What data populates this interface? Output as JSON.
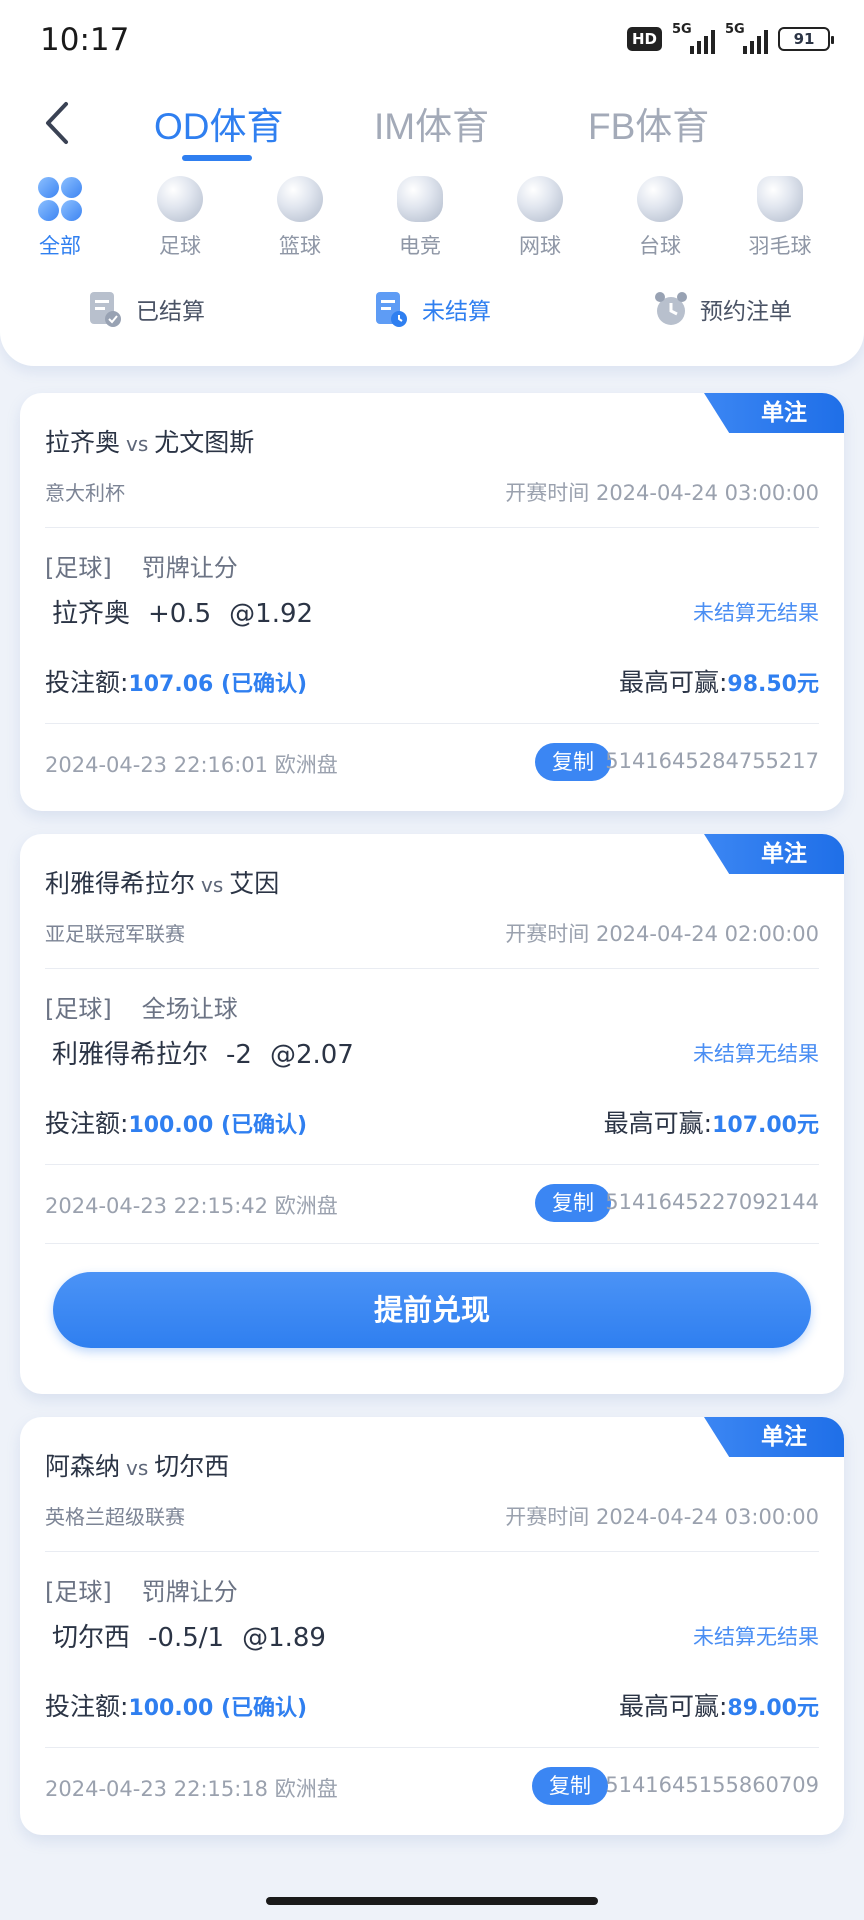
{
  "status_bar": {
    "time": "10:17",
    "hd": "HD",
    "net1": "5G",
    "net2": "5G",
    "battery": "91"
  },
  "header": {
    "tabs": [
      "OD体育",
      "IM体育",
      "FB体育"
    ],
    "active_tab": "OD体育",
    "sports": [
      {
        "label": "全部",
        "icon": "all-clover-icon"
      },
      {
        "label": "足球",
        "icon": "soccer-ball-icon"
      },
      {
        "label": "篮球",
        "icon": "basketball-icon"
      },
      {
        "label": "电竞",
        "icon": "gamepad-icon"
      },
      {
        "label": "网球",
        "icon": "tennis-ball-icon"
      },
      {
        "label": "台球",
        "icon": "billiard-ball-icon"
      },
      {
        "label": "羽毛球",
        "icon": "shuttlecock-icon"
      }
    ],
    "status_tabs": [
      {
        "label": "已结算",
        "icon": "settled-doc-icon"
      },
      {
        "label": "未结算",
        "icon": "unsettled-clock-doc-icon"
      },
      {
        "label": "预约注单",
        "icon": "alarm-clock-icon"
      }
    ],
    "active_status_tab": "未结算"
  },
  "bets": [
    {
      "type": "单注",
      "home": "拉齐奥",
      "vs": "vs",
      "away": "尤文图斯",
      "league": "意大利杯",
      "start_label": "开赛时间",
      "start_time": "2024-04-24 03:00:00",
      "sport": "[足球]",
      "market": "罚牌让分",
      "pick_team": "拉齐奥",
      "pick_line": "+0.5",
      "pick_odds": "@1.92",
      "result": "未结算无结果",
      "stake_label": "投注额:",
      "stake": "107.06 (已确认)",
      "win_label": "最高可赢:",
      "win": "98.50元",
      "bet_time": "2024-04-23 22:16:01 欧洲盘",
      "copy": "复制",
      "order_id": "5141645284755217"
    },
    {
      "type": "单注",
      "home": "利雅得希拉尔",
      "vs": "vs",
      "away": "艾因",
      "league": "亚足联冠军联赛",
      "start_label": "开赛时间",
      "start_time": "2024-04-24 02:00:00",
      "sport": "[足球]",
      "market": "全场让球",
      "pick_team": "利雅得希拉尔",
      "pick_line": "-2",
      "pick_odds": "@2.07",
      "result": "未结算无结果",
      "stake_label": "投注额:",
      "stake": "100.00 (已确认)",
      "win_label": "最高可赢:",
      "win": "107.00元",
      "bet_time": "2024-04-23 22:15:42 欧洲盘",
      "copy": "复制",
      "order_id": "5141645227092144",
      "cashout": "提前兑现"
    },
    {
      "type": "单注",
      "home": "阿森纳",
      "vs": "vs",
      "away": "切尔西",
      "league": "英格兰超级联赛",
      "start_label": "开赛时间",
      "start_time": "2024-04-24 03:00:00",
      "sport": "[足球]",
      "market": "罚牌让分",
      "pick_team": "切尔西",
      "pick_line": "-0.5/1",
      "pick_odds": "@1.89",
      "result": "未结算无结果",
      "stake_label": "投注额:",
      "stake": "100.00 (已确认)",
      "win_label": "最高可赢:",
      "win": "89.00元",
      "bet_time": "2024-04-23 22:15:18 欧洲盘",
      "copy": "复制",
      "order_id": "5141645155860709"
    }
  ],
  "colors": {
    "accent": "#2f7ff0",
    "background": "#eef2f9",
    "muted": "#9aa1ae"
  }
}
